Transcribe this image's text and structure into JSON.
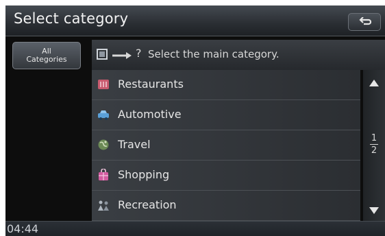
{
  "header": {
    "title": "Select category",
    "back_icon": "back-arrow-icon"
  },
  "sidebar": {
    "all_categories_line1": "All",
    "all_categories_line2": "Categories"
  },
  "hint": {
    "question_mark": "?",
    "text": "Select the main category."
  },
  "categories": [
    {
      "label": "Restaurants",
      "icon": "restaurant-icon",
      "color": "#c85a6e"
    },
    {
      "label": "Automotive",
      "icon": "car-icon",
      "color": "#5aa0d8"
    },
    {
      "label": "Travel",
      "icon": "globe-icon",
      "color": "#8fa870"
    },
    {
      "label": "Shopping",
      "icon": "shopping-bag-icon",
      "color": "#d35ca0"
    },
    {
      "label": "Recreation",
      "icon": "recreation-icon",
      "color": "#b0b7c0"
    }
  ],
  "pagination": {
    "current": "1",
    "total": "2"
  },
  "status": {
    "clock": "04:44"
  }
}
